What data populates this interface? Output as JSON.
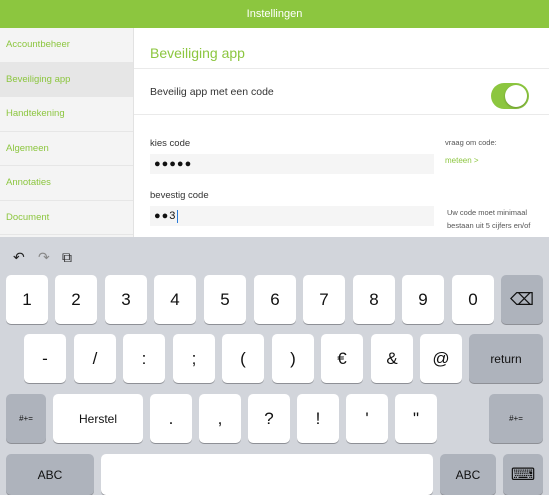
{
  "title": "Instellingen",
  "sidebar": {
    "items": [
      {
        "label": "Accountbeheer"
      },
      {
        "label": "Beveiliging app"
      },
      {
        "label": "Handtekening"
      },
      {
        "label": "Algemeen"
      },
      {
        "label": "Annotaties"
      },
      {
        "label": "Document"
      }
    ]
  },
  "content": {
    "section_title": "Beveiliging app",
    "secure_label": "Beveilig app met een code",
    "toggle_on": true,
    "choose_label": "kies code",
    "choose_value": "●●●●●",
    "confirm_label": "bevestig code",
    "confirm_value": "●●3",
    "question_label": "vraag om code:",
    "question_link": "meteen >",
    "hint_line1": "Uw code moet minimaal",
    "hint_line2": "bestaan uit 5 cijfers en/of"
  },
  "keyboard": {
    "toolbar": {
      "undo": "↶",
      "redo": "↷",
      "paste": "⧉"
    },
    "row1": [
      "1",
      "2",
      "3",
      "4",
      "5",
      "6",
      "7",
      "8",
      "9",
      "0"
    ],
    "delete": "⌫",
    "row2": [
      "-",
      "/",
      ":",
      ";",
      "(",
      ")",
      "€",
      "&",
      "@"
    ],
    "return": "return",
    "row3_mode": "#+=",
    "herstel": "Herstel",
    "row3": [
      ".",
      ",",
      "?",
      "!",
      "'",
      "\""
    ],
    "row3_mode_right": "#+=",
    "abc_left": "ABC",
    "abc_right": "ABC",
    "hide": "⌨"
  },
  "colors": {
    "accent": "#8cc63f",
    "keyboard_bg": "#d2d5db"
  }
}
